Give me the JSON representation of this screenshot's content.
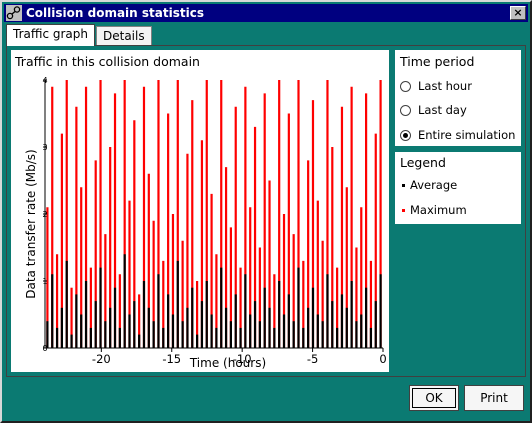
{
  "window": {
    "title": "Collision domain statistics",
    "close_glyph": "×",
    "app_icon": "network-nodes-icon"
  },
  "tabs": [
    {
      "label": "Traffic graph",
      "active": true
    },
    {
      "label": "Details",
      "active": false
    }
  ],
  "graph": {
    "title": "Traffic in this collision domain"
  },
  "time_period": {
    "heading": "Time period",
    "options": [
      {
        "label": "Last hour",
        "checked": false
      },
      {
        "label": "Last day",
        "checked": false
      },
      {
        "label": "Entire simulation",
        "checked": true
      }
    ]
  },
  "legend": {
    "heading": "Legend",
    "items": [
      {
        "label": "Average",
        "color": "#000000"
      },
      {
        "label": "Maximum",
        "color": "#ff0000"
      }
    ]
  },
  "buttons": {
    "ok": "OK",
    "print": "Print"
  },
  "chart_data": {
    "type": "bar",
    "title": "Traffic in this collision domain",
    "xlabel": "Time (hours)",
    "ylabel": "Data transfer rate (Mb/s)",
    "xlim": [
      -24,
      0
    ],
    "ylim": [
      0,
      4
    ],
    "x_ticks": [
      -20,
      -15,
      -10,
      -5,
      0
    ],
    "x_tick_labels": [
      "-20",
      "-15",
      "-10",
      "-5",
      "0"
    ],
    "y_ticks": [
      0,
      1,
      2,
      3,
      4
    ],
    "y_tick_labels": [
      "0",
      "1",
      "2",
      "3",
      "4"
    ],
    "series": [
      {
        "name": "Average",
        "color": "#000000",
        "values": [
          0.4,
          1.1,
          0.3,
          0.6,
          1.3,
          0.2,
          0.8,
          0.5,
          1.0,
          0.3,
          0.7,
          1.2,
          0.4,
          0.6,
          0.9,
          0.3,
          1.4,
          0.5,
          0.7,
          0.2,
          1.0,
          0.6,
          0.4,
          1.1,
          0.3,
          0.8,
          0.5,
          1.3,
          0.4,
          0.6,
          0.9,
          0.2,
          0.7,
          1.0,
          0.5,
          0.3,
          1.2,
          0.6,
          0.4,
          0.8,
          0.3,
          1.1,
          0.5,
          0.7,
          0.4,
          0.9,
          0.6,
          0.3,
          1.0,
          0.5,
          0.8,
          0.4,
          1.2,
          0.3,
          0.6,
          0.9,
          0.5,
          0.4,
          1.1,
          0.7,
          0.3,
          0.8,
          0.6,
          1.0,
          0.4,
          0.5,
          0.9,
          0.3,
          0.7,
          1.1
        ]
      },
      {
        "name": "Maximum",
        "color": "#ff0000",
        "values": [
          2.1,
          3.9,
          1.4,
          3.2,
          4.0,
          0.9,
          3.6,
          2.4,
          3.9,
          1.2,
          2.8,
          4.0,
          1.7,
          3.0,
          3.8,
          1.1,
          4.0,
          2.2,
          3.4,
          0.8,
          3.9,
          2.6,
          1.9,
          4.0,
          1.3,
          3.5,
          2.0,
          4.0,
          1.6,
          2.9,
          3.7,
          1.0,
          3.1,
          4.0,
          2.3,
          1.4,
          4.0,
          2.7,
          1.8,
          3.6,
          1.2,
          3.9,
          2.1,
          3.3,
          1.5,
          3.8,
          2.5,
          1.1,
          4.0,
          2.0,
          3.5,
          1.7,
          4.0,
          1.3,
          2.8,
          3.7,
          2.2,
          1.6,
          4.0,
          3.0,
          1.2,
          3.6,
          2.4,
          3.9,
          1.5,
          2.1,
          3.8,
          1.3,
          3.2,
          4.0
        ]
      }
    ],
    "grid": false,
    "legend_position": "right"
  }
}
